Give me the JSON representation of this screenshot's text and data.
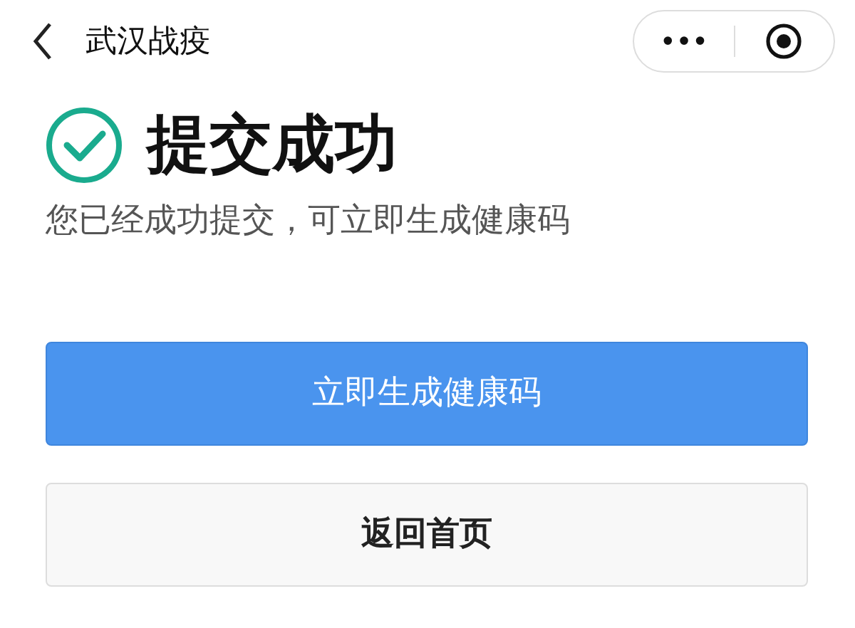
{
  "nav_bar": {
    "title": "武汉战疫",
    "menu_glyph": "•••"
  },
  "result": {
    "title": "提交成功",
    "message": "您已经成功提交，可立即生成健康码"
  },
  "buttons": [
    {
      "label": "立即生成健康码",
      "kind": "primary"
    },
    {
      "label": "返回首页",
      "kind": "secondary"
    }
  ]
}
